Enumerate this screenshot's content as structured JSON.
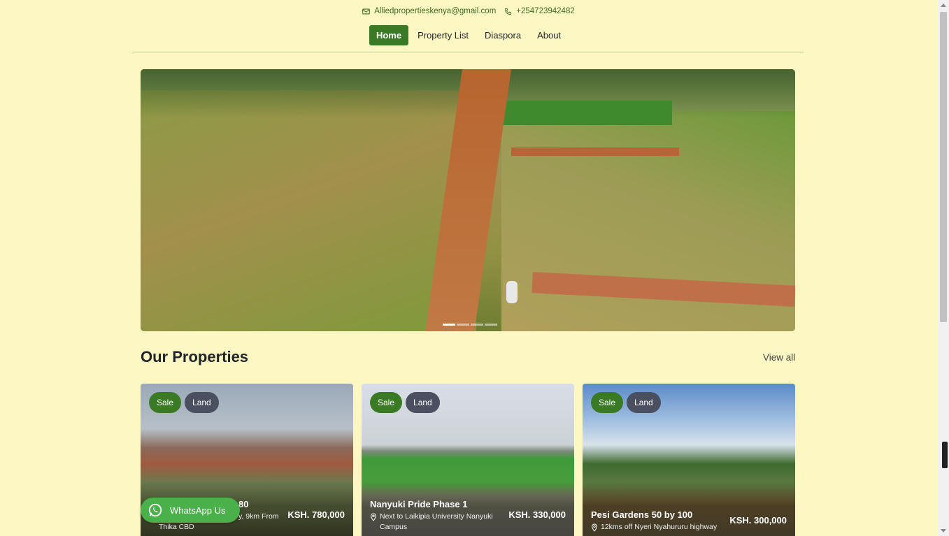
{
  "contact": {
    "email": "Alliedpropertieskenya@gmail.com",
    "email_icon": "envelope-icon",
    "phone": "+254723942482",
    "phone_icon": "phone-icon"
  },
  "nav": {
    "items": [
      {
        "label": "Home",
        "active": true
      },
      {
        "label": "Property List",
        "active": false
      },
      {
        "label": "Diaspora",
        "active": false
      },
      {
        "label": "About",
        "active": false
      }
    ]
  },
  "carousel": {
    "slide_count": 4,
    "active_index": 0
  },
  "properties": {
    "title": "Our Properties",
    "view_all": "View all",
    "cards": [
      {
        "badges": [
          "Sale",
          "Land"
        ],
        "title": "80",
        "location_line1": "y, 9km From",
        "location_line2": "Thika CBD",
        "price": "KSH. 780,000"
      },
      {
        "badges": [
          "Sale",
          "Land"
        ],
        "title": "Nanyuki Pride Phase 1",
        "location_line1": "Next to Laikipia University Nanyuki",
        "location_line2": "Campus",
        "price": "KSH. 330,000"
      },
      {
        "badges": [
          "Sale",
          "Land"
        ],
        "title": "Pesi Gardens 50 by 100",
        "location_line1": "12kms off Nyeri Nyahururu highway",
        "location_line2": "",
        "price": "KSH. 300,000"
      }
    ]
  },
  "whatsapp": {
    "label": "WhatsApp Us",
    "icon": "whatsapp-icon"
  },
  "colors": {
    "background": "#fdf8c3",
    "accent": "#3b7a24",
    "badge_land": "#4a5060",
    "whatsapp": "#4ab04a"
  }
}
